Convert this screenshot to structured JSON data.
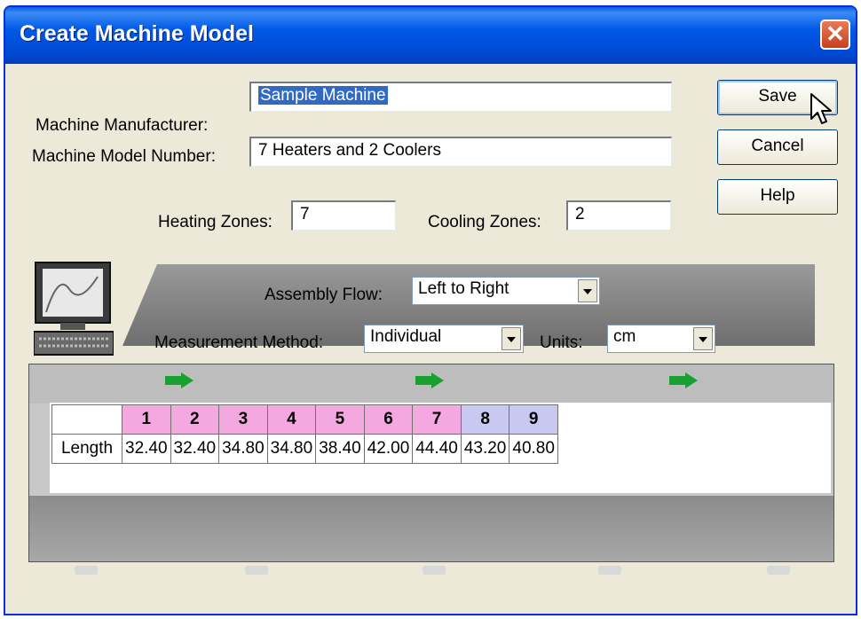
{
  "window": {
    "title": "Create Machine Model",
    "close_glyph": "✕"
  },
  "form": {
    "manufacturer_label": "Machine Manufacturer:",
    "manufacturer_value": "Sample Machine",
    "model_label": "Machine Model Number:",
    "model_value": "7 Heaters and 2 Coolers",
    "heating_label": "Heating Zones:",
    "heating_value": "7",
    "cooling_label": "Cooling Zones:",
    "cooling_value": "2"
  },
  "buttons": {
    "save": "Save",
    "cancel": "Cancel",
    "help": "Help"
  },
  "panel": {
    "assembly_flow_label": "Assembly Flow:",
    "assembly_flow_value": "Left to Right",
    "measurement_label": "Measurement Method:",
    "measurement_value": "Individual",
    "units_label": "Units:",
    "units_value": "cm"
  },
  "zones": {
    "row_label": "Length",
    "headers": [
      "1",
      "2",
      "3",
      "4",
      "5",
      "6",
      "7",
      "8",
      "9"
    ],
    "lengths": [
      "32.40",
      "32.40",
      "34.80",
      "34.80",
      "38.40",
      "42.00",
      "44.40",
      "43.20",
      "40.80"
    ],
    "types": [
      "heat",
      "heat",
      "heat",
      "heat",
      "heat",
      "heat",
      "heat",
      "cool",
      "cool"
    ]
  },
  "colors": {
    "heat_zone": "#f4a8e0",
    "cool_zone": "#c8c8f0",
    "titlebar": "#0054e3",
    "flow_arrow": "#18a030"
  }
}
